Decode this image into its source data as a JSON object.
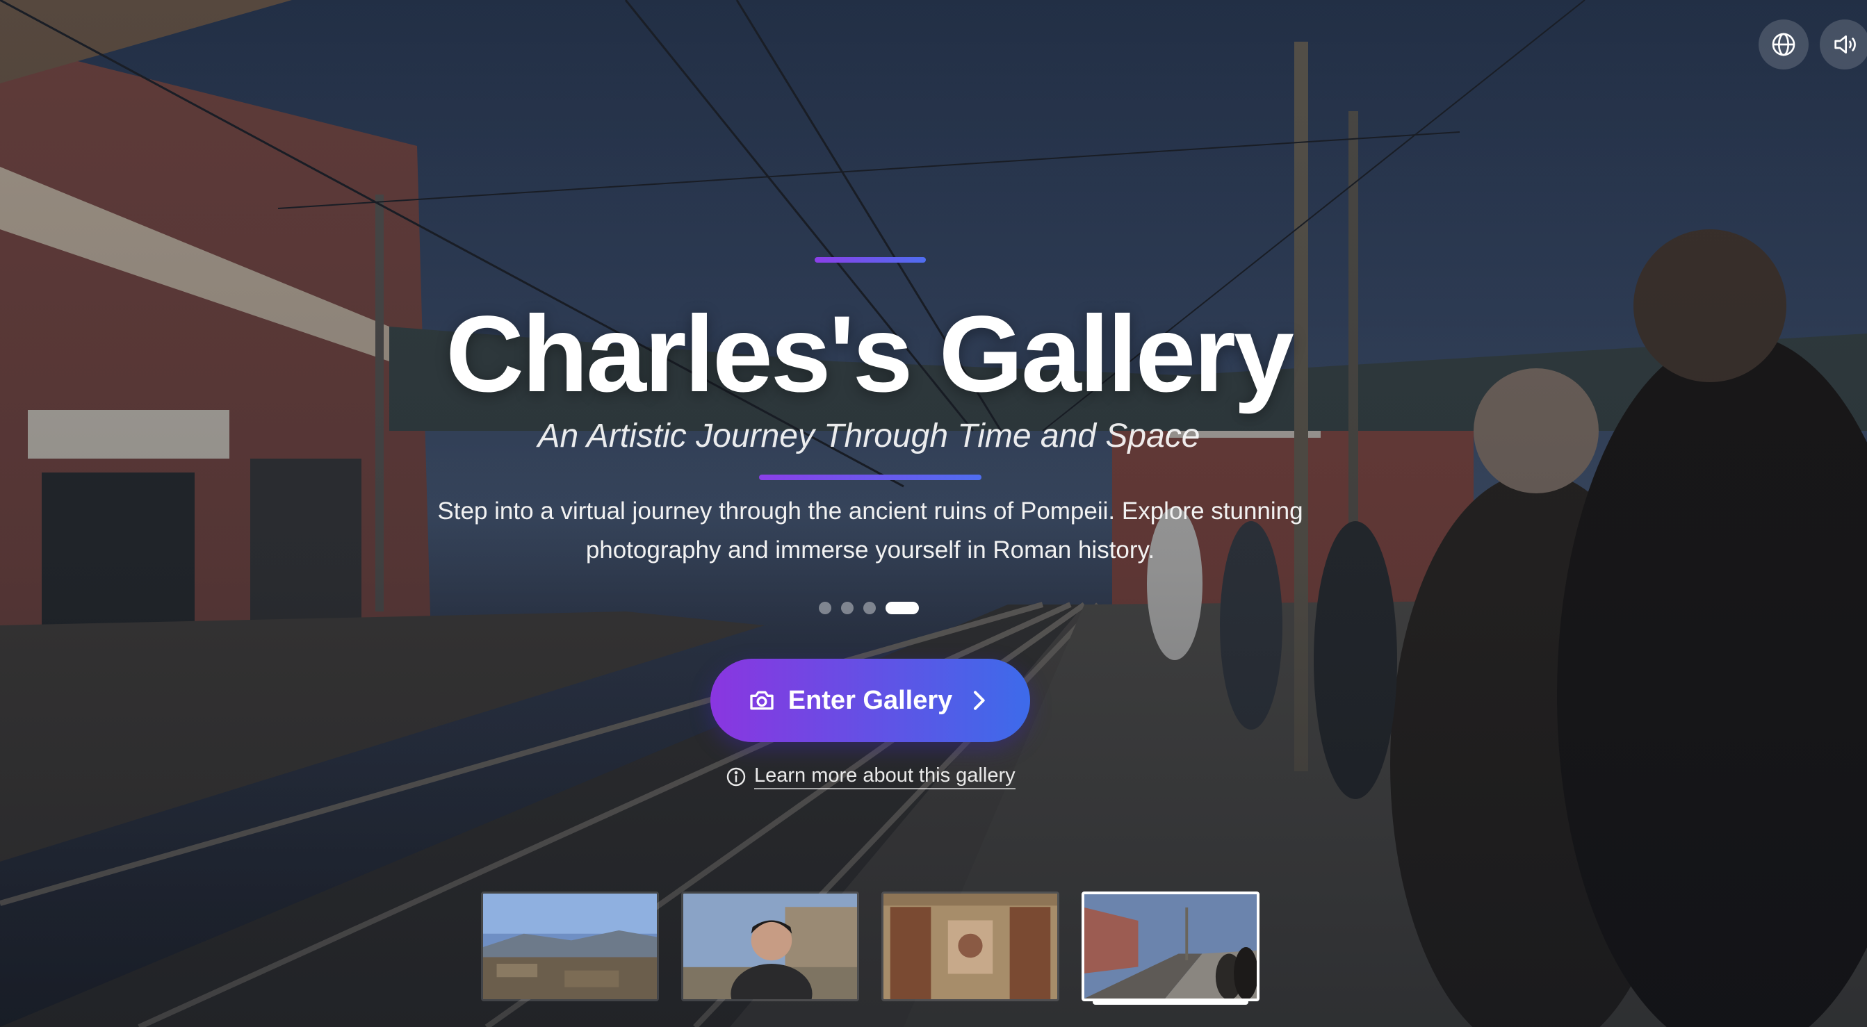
{
  "controls": {
    "language_icon": "globe-icon",
    "sound_icon": "speaker-icon"
  },
  "hero": {
    "title": "Charles's Gallery",
    "subtitle": "An Artistic Journey Through Time and Space",
    "description": "Step into a virtual journey through the ancient ruins of Pompeii. Explore stunning photography and immerse yourself in Roman history.",
    "accent_start": "#8a36e0",
    "accent_end": "#3d6bea"
  },
  "slides": {
    "count": 4,
    "active_index": 3
  },
  "cta": {
    "enter_label": "Enter Gallery",
    "enter_icon": "camera-icon",
    "arrow_icon": "chevron-right-icon",
    "learn_label": "Learn more about this gallery",
    "learn_icon": "info-icon"
  },
  "thumbnails": [
    {
      "name": "pompeii-ruins-landscape",
      "active": false
    },
    {
      "name": "portrait-at-ruins",
      "active": false
    },
    {
      "name": "fresco-wall",
      "active": false
    },
    {
      "name": "pompei-scavi-station",
      "active": true
    }
  ]
}
